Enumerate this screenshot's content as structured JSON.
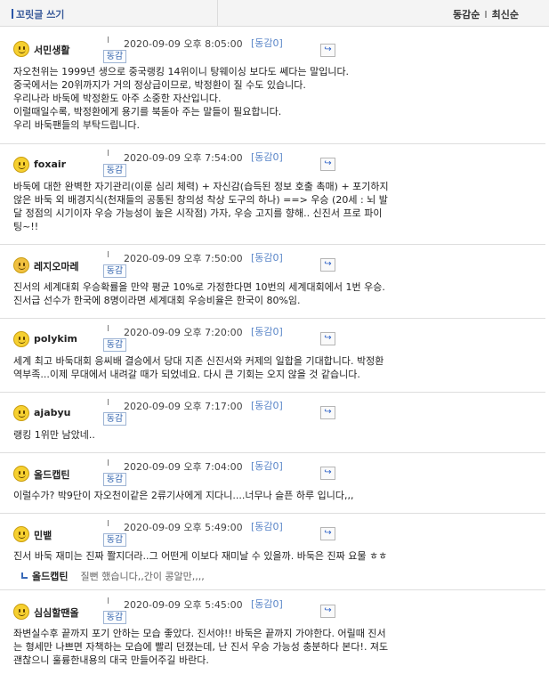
{
  "header": {
    "write_label": "꼬릿글 쓰기",
    "sort_agree": "동감순",
    "sort_sep": "I",
    "sort_latest": "최신순"
  },
  "common": {
    "pipe": "I",
    "agree_button": "동감",
    "reply_icon": "reply-arrow-icon"
  },
  "comments": [
    {
      "author": "서민생활",
      "date": "2020-09-09 오후 8:05:00",
      "agree": "동감0",
      "body": "자오천위는 1999년 생으로 중국랭킹 14위이니 탕웨이싱 보다도 쎄다는 말입니다.\n중국에서는 20위까지가 거의 정상급이므로, 박정환이 질 수도 있습니다.\n우리나라 바둑에 박정환도 아주 소중한 자산입니다.\n이럴때일수록, 박정환에게 용기를 북돋아 주는 말들이 필요합니다.\n우리 바둑팬들의 부탁드립니다."
    },
    {
      "author": "foxair",
      "date": "2020-09-09 오후 7:54:00",
      "agree": "동감0",
      "body": "바둑에 대한 완벽한 자기관리(이룬 심리 체력) + 자신감(습득된 정보 호출 촉매) + 포기하지\n않은 바둑 외 배경지식(천재들의 공통된 창의성 착상 도구의 하나) ==> 우승 (20세 : 뇌 발\n달 정점의 시기이자 우승 가능성이 높은 시작점) 가자, 우승 고지를 향해.. 신진서 프로 파이\n팅~!!"
    },
    {
      "author": "레지오마레",
      "date": "2020-09-09 오후 7:50:00",
      "agree": "동감0",
      "body": "진서의 세계대회 우승확률을 만약 평균 10%로 가정한다면 10번의 세계대회에서 1번 우승.\n진서급 선수가 한국에 8명이라면 세계대회 우승비율은 한국이 80%임."
    },
    {
      "author": "polykim",
      "date": "2020-09-09 오후 7:20:00",
      "agree": "동감0",
      "body": "세계 최고 바둑대회 응씨배 결승에서 당대 지존 신진서와 커제의 일합을 기대합니다. 박정환\n역부족...이제 무대에서 내려갈 때가 되었네요. 다시 큰 기회는 오지 않을 것 같습니다."
    },
    {
      "author": "ajabyu",
      "date": "2020-09-09 오후 7:17:00",
      "agree": "동감0",
      "body": "랭킹 1위만 남았네.."
    },
    {
      "author": "올드캡틴",
      "date": "2020-09-09 오후 7:04:00",
      "agree": "동감0",
      "body": "이럴수가? 박9단이 자오천이같은 2류기사에게 지다니....너무나 슬픈 하루 입니다,,,"
    },
    {
      "author": "민뱉",
      "date": "2020-09-09 오후 5:49:00",
      "agree": "동감0",
      "body": "진서 바둑 재미는 진짜 쫠지더라..그 어떤게 이보다 재미날 수 있을까. 바둑은 진짜 요물 ㅎㅎ",
      "reply": {
        "author": "올드캡틴",
        "text": "질뻔 했습니다,,간이 콩알만,,,,"
      }
    },
    {
      "author": "심심할땐올",
      "date": "2020-09-09 오후 5:45:00",
      "agree": "동감0",
      "body": "좌변실수후 끝까지 포기 안하는 모습 좋았다. 진서야!! 바둑은 끝까지 가야한다. 어릴때 진서\n는 형세만 나쁘면 자책하는 모습에 빨리 던졌는데, 난 진서 우승 가능성 충분하다 본다!. 져도\n괜찮으니 훌륭한내용의 대국 만들어주길 바란다."
    }
  ]
}
